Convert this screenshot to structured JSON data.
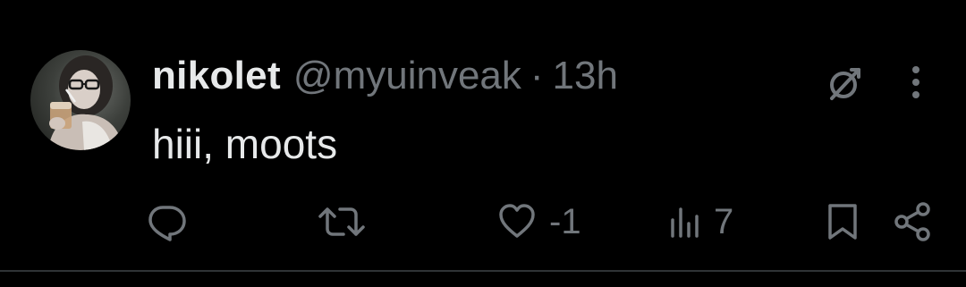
{
  "tweet": {
    "author": {
      "display_name": "nikolet",
      "handle": "@myuinveak",
      "avatar_icon": "profile-photo"
    },
    "separator": "·",
    "time": "13h",
    "text": "hiii, moots",
    "header_actions": {
      "grok_icon": "grok-icon",
      "more_icon": "more-vertical-icon"
    },
    "actions": {
      "reply": {
        "icon": "reply-icon",
        "count": ""
      },
      "retweet": {
        "icon": "retweet-icon",
        "count": ""
      },
      "like": {
        "icon": "heart-icon",
        "count": "-1"
      },
      "views": {
        "icon": "views-icon",
        "count": "7"
      },
      "bookmark": {
        "icon": "bookmark-icon"
      },
      "share": {
        "icon": "share-icon"
      }
    }
  },
  "colors": {
    "background": "#000000",
    "primary_text": "#e7e9ea",
    "secondary_text": "#71767b",
    "divider": "#2f3336"
  }
}
